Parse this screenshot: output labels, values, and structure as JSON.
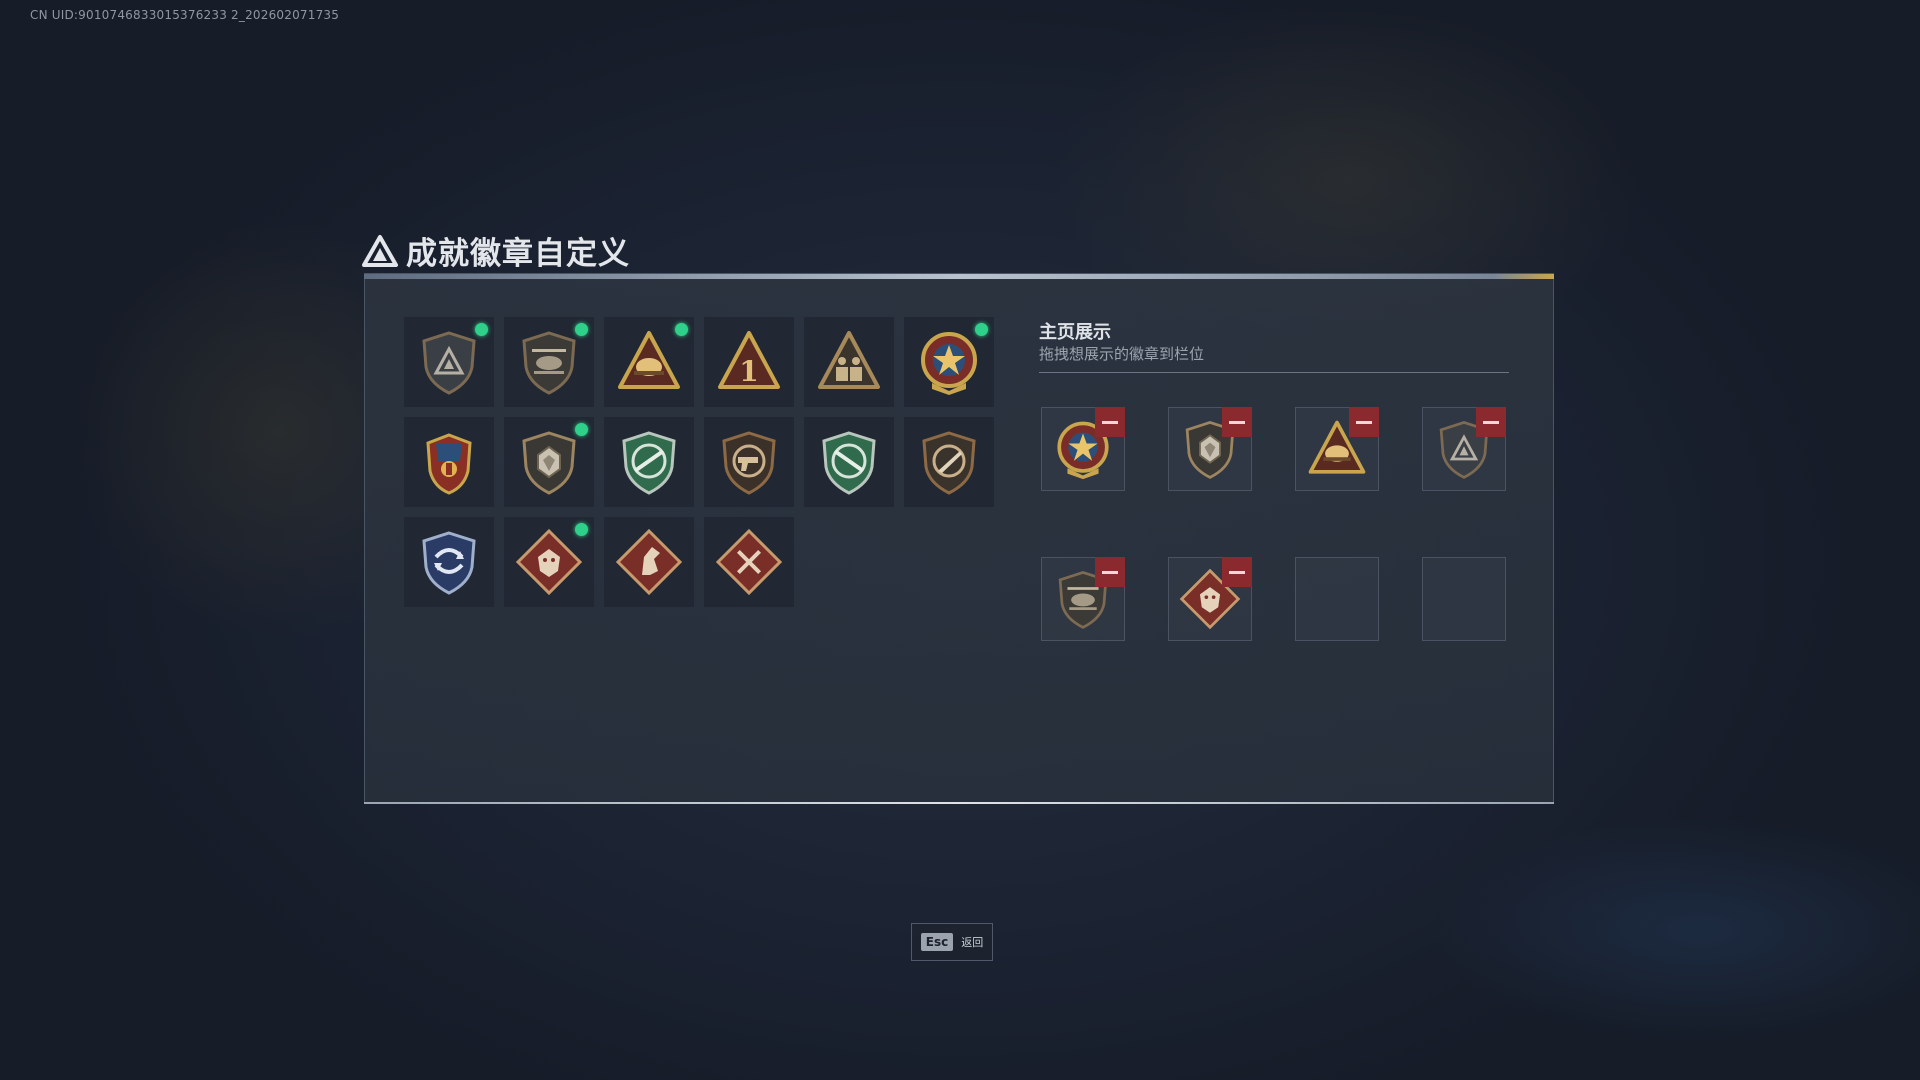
{
  "uid_text": "CN UID:9010746833015376233 2_202602071735",
  "title": "成就徽章自定义",
  "showcase": {
    "title": "主页展示",
    "subtitle": "拖拽想展示的徽章到栏位"
  },
  "badges": [
    {
      "icon": "shield-delta-icon",
      "new": true
    },
    {
      "icon": "helicopter-shield-icon",
      "new": true
    },
    {
      "icon": "triangle-helmet-icon",
      "new": true
    },
    {
      "icon": "triangle-number-one-icon",
      "new": false
    },
    {
      "icon": "triangle-soldiers-icon",
      "new": false
    },
    {
      "icon": "star-medal-icon",
      "new": true
    },
    {
      "icon": "winged-shield-crest-icon",
      "new": false
    },
    {
      "icon": "shield-gem-icon",
      "new": true
    },
    {
      "icon": "green-shield-rifle-icon",
      "new": false
    },
    {
      "icon": "bronze-shield-pistol-icon",
      "new": false
    },
    {
      "icon": "green-shield-rifle-alt-icon",
      "new": false
    },
    {
      "icon": "bronze-shield-knife-icon",
      "new": false
    },
    {
      "icon": "blue-shield-arrows-icon",
      "new": false
    },
    {
      "icon": "diamond-dragon-icon",
      "new": true
    },
    {
      "icon": "diamond-horse-icon",
      "new": false
    },
    {
      "icon": "diamond-blades-icon",
      "new": false
    }
  ],
  "slots": [
    {
      "icon": "star-medal-icon",
      "filled": true
    },
    {
      "icon": "shield-gem-icon",
      "filled": true
    },
    {
      "icon": "triangle-helmet-icon",
      "filled": true
    },
    {
      "icon": "shield-delta-icon",
      "filled": true
    },
    {
      "icon": "helicopter-shield-icon",
      "filled": true
    },
    {
      "icon": "diamond-dragon-icon",
      "filled": true
    },
    {
      "icon": "",
      "filled": false
    },
    {
      "icon": "",
      "filled": false
    }
  ],
  "footer": {
    "key": "Esc",
    "label": "返回"
  },
  "colors": {
    "new_dot": "#2fd08a",
    "remove_button": "#8a2a2e",
    "gold": "#c9a64d",
    "bronze": "#8d6a45",
    "green_shield": "#2f6b4c",
    "red_diamond": "#7a2e28"
  }
}
